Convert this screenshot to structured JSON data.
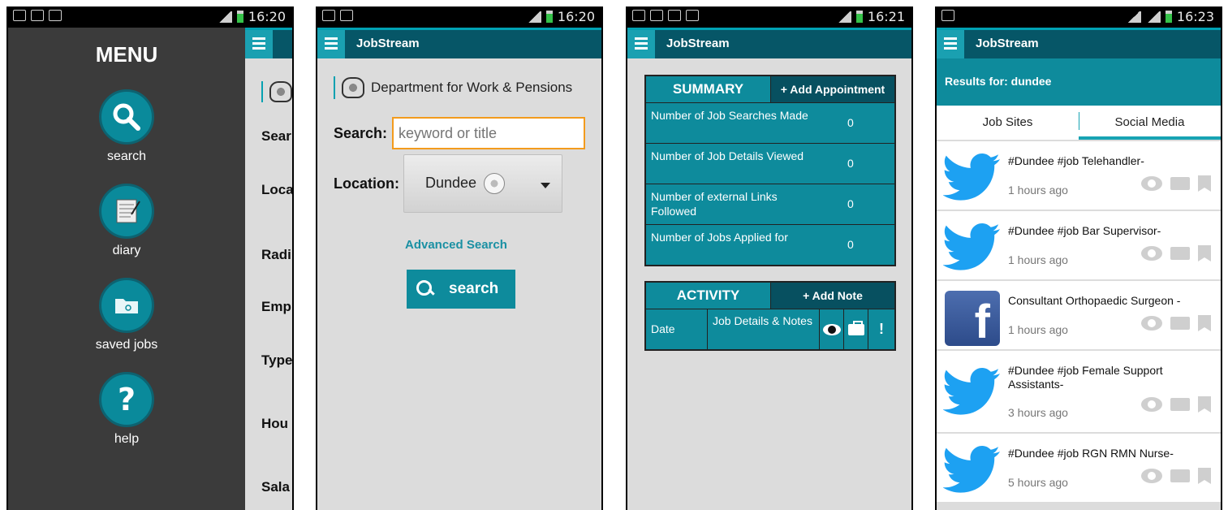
{
  "status_times": [
    "16:20",
    "16:20",
    "16:21",
    "16:23"
  ],
  "app": {
    "title": "JobStream"
  },
  "menu": {
    "title": "MENU",
    "items": [
      {
        "label": "search",
        "icon": "search-icon"
      },
      {
        "label": "diary",
        "icon": "diary-icon"
      },
      {
        "label": "saved jobs",
        "icon": "folder-icon"
      },
      {
        "label": "help",
        "icon": "help-icon"
      }
    ],
    "behind_labels": [
      "Sear",
      "Loca",
      "Radi",
      "Emp",
      "Type",
      "Hou",
      "Sala"
    ]
  },
  "search_screen": {
    "department": "Department for Work & Pensions",
    "search_label": "Search:",
    "search_placeholder": "keyword or title",
    "location_label": "Location:",
    "location_value": "Dundee",
    "advanced_link": "Advanced Search",
    "search_button": "search"
  },
  "diary_screen": {
    "summary_header": "SUMMARY",
    "add_appointment": "+ Add Appointment",
    "rows": [
      {
        "label": "Number of Job Searches Made",
        "value": "0"
      },
      {
        "label": "Number of Job Details Viewed",
        "value": "0"
      },
      {
        "label": "Number of external Links Followed",
        "value": "0"
      },
      {
        "label": "Number of Jobs Applied for",
        "value": "0"
      }
    ],
    "activity_header": "ACTIVITY",
    "add_note": "+ Add Note",
    "activity_cols": {
      "date": "Date",
      "details": "Job Details & Notes",
      "flag": "!"
    }
  },
  "results_screen": {
    "results_for": "Results for: dundee",
    "tabs": [
      "Job Sites",
      "Social Media"
    ],
    "active_tab": "Social Media",
    "items": [
      {
        "source": "twitter",
        "title": "#Dundee #job Telehandler-",
        "time": "1 hours ago"
      },
      {
        "source": "twitter",
        "title": "#Dundee #job Bar Supervisor-",
        "time": "1 hours ago"
      },
      {
        "source": "facebook",
        "title": "Consultant Orthopaedic Surgeon -",
        "time": "1 hours ago"
      },
      {
        "source": "twitter",
        "title": "#Dundee #job Female Support Assistants-",
        "time": "3 hours ago"
      },
      {
        "source": "twitter",
        "title": "#Dundee #job RGN RMN Nurse-",
        "time": "5 hours ago"
      }
    ]
  },
  "colors": {
    "teal": "#0e8b9c",
    "dark_teal": "#065667",
    "accent_orange": "#f39b1d",
    "twitter_blue": "#1da1f2",
    "facebook_blue": "#3b5998"
  }
}
